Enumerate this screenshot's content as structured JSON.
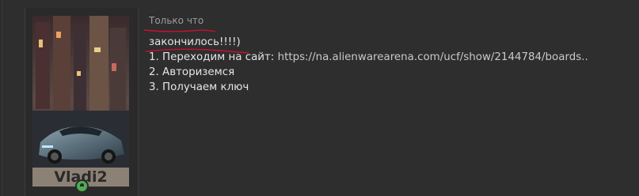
{
  "post": {
    "timestamp": "Только что",
    "author": {
      "avatar_text": "Vladi2",
      "status": "online"
    },
    "lines": {
      "headline": "закончилось!!!!)",
      "step1_label": "1. Переходим на сайт: ",
      "step1_link": "https://na.alienwarearena.com/ucf/show/2144784/boards..",
      "step2": "2. Авториземся",
      "step3": "3. Получаем ключ"
    }
  },
  "colors": {
    "background": "#2e2e2e",
    "annotation": "#c8102e",
    "online": "#4caf50"
  }
}
